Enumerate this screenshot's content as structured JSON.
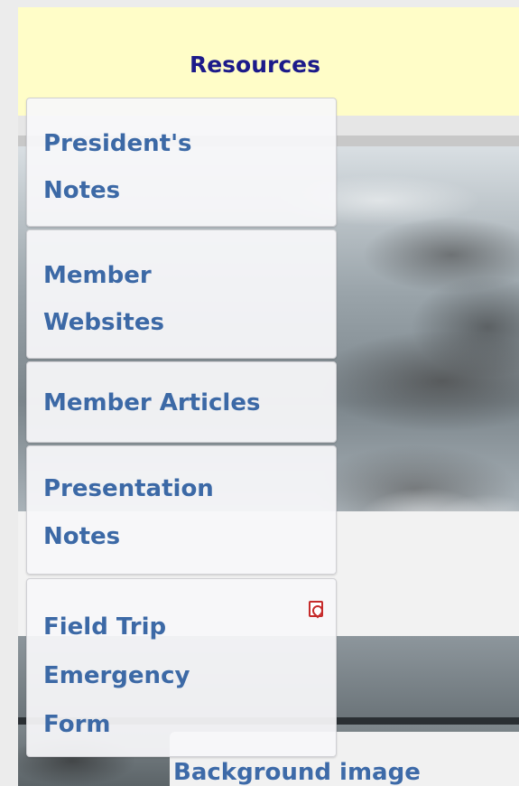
{
  "header": {
    "title": "Resources"
  },
  "menu": {
    "items": [
      {
        "label_line1": "President's",
        "label_line2": "Notes"
      },
      {
        "label_line1": "Member",
        "label_line2": "Websites"
      },
      {
        "label_line1": "Member Articles"
      },
      {
        "label_line1": "Presentation",
        "label_line2": "Notes"
      },
      {
        "label_line1": "Field Trip",
        "label_line2": "Emergency",
        "label_line3": "Form",
        "icon": "pdf-icon"
      }
    ]
  },
  "background": {
    "caption": "Background image"
  },
  "colors": {
    "header_bg": "#fffdc8",
    "header_text": "#1c1a8a",
    "link": "#3c69a6",
    "pdf_icon": "#c62b2b"
  }
}
